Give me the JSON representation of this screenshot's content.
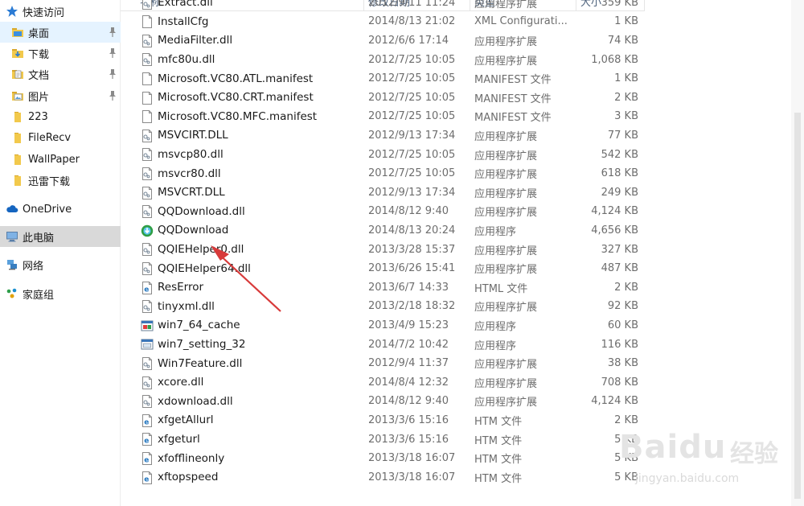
{
  "nav": {
    "items": [
      {
        "label": "快速访问",
        "icon": "star-icon",
        "kind": "quick",
        "pinned": false
      },
      {
        "label": "桌面",
        "icon": "desktop-folder-icon",
        "kind": "folder-blue",
        "pinned": true,
        "selected": true
      },
      {
        "label": "下载",
        "icon": "download-folder-icon",
        "kind": "folder-down",
        "pinned": true
      },
      {
        "label": "文档",
        "icon": "documents-folder-icon",
        "kind": "folder-doc",
        "pinned": true
      },
      {
        "label": "图片",
        "icon": "pictures-folder-icon",
        "kind": "folder-pic",
        "pinned": true
      },
      {
        "label": "223",
        "icon": "folder-icon",
        "kind": "folder",
        "pinned": false
      },
      {
        "label": "FileRecv",
        "icon": "folder-icon",
        "kind": "folder",
        "pinned": false
      },
      {
        "label": "WallPaper",
        "icon": "folder-icon",
        "kind": "folder",
        "pinned": false
      },
      {
        "label": "迅雷下载",
        "icon": "folder-icon",
        "kind": "folder",
        "pinned": false
      },
      {
        "label": "OneDrive",
        "icon": "onedrive-cloud-icon",
        "kind": "cloud",
        "pinned": false
      },
      {
        "label": "此电脑",
        "icon": "this-pc-icon",
        "kind": "pc",
        "pinned": false,
        "pcSelected": true
      },
      {
        "label": "网络",
        "icon": "network-icon",
        "kind": "network",
        "pinned": false
      },
      {
        "label": "家庭组",
        "icon": "homegroup-icon",
        "kind": "homegroup",
        "pinned": false
      }
    ]
  },
  "header": {
    "name": "名称",
    "date": "修改日期",
    "type": "类型",
    "size": "大小"
  },
  "files": [
    {
      "name": "Extract.dll",
      "date": "2012/9/11 11:24",
      "type": "应用程序扩展",
      "size": "359 KB",
      "icon": "dll-file-icon"
    },
    {
      "name": "InstallCfg",
      "date": "2014/8/13 21:02",
      "type": "XML Configurati...",
      "size": "1 KB",
      "icon": "blank-file-icon"
    },
    {
      "name": "MediaFilter.dll",
      "date": "2012/6/6 17:14",
      "type": "应用程序扩展",
      "size": "74 KB",
      "icon": "dll-file-icon"
    },
    {
      "name": "mfc80u.dll",
      "date": "2012/7/25 10:05",
      "type": "应用程序扩展",
      "size": "1,068 KB",
      "icon": "dll-file-icon"
    },
    {
      "name": "Microsoft.VC80.ATL.manifest",
      "date": "2012/7/25 10:05",
      "type": "MANIFEST 文件",
      "size": "1 KB",
      "icon": "blank-file-icon"
    },
    {
      "name": "Microsoft.VC80.CRT.manifest",
      "date": "2012/7/25 10:05",
      "type": "MANIFEST 文件",
      "size": "2 KB",
      "icon": "blank-file-icon"
    },
    {
      "name": "Microsoft.VC80.MFC.manifest",
      "date": "2012/7/25 10:05",
      "type": "MANIFEST 文件",
      "size": "3 KB",
      "icon": "blank-file-icon"
    },
    {
      "name": "MSVCIRT.DLL",
      "date": "2012/9/13 17:34",
      "type": "应用程序扩展",
      "size": "77 KB",
      "icon": "dll-file-icon"
    },
    {
      "name": "msvcp80.dll",
      "date": "2012/7/25 10:05",
      "type": "应用程序扩展",
      "size": "542 KB",
      "icon": "dll-file-icon"
    },
    {
      "name": "msvcr80.dll",
      "date": "2012/7/25 10:05",
      "type": "应用程序扩展",
      "size": "618 KB",
      "icon": "dll-file-icon"
    },
    {
      "name": "MSVCRT.DLL",
      "date": "2012/9/13 17:34",
      "type": "应用程序扩展",
      "size": "249 KB",
      "icon": "dll-file-icon"
    },
    {
      "name": "QQDownload.dll",
      "date": "2014/8/12 9:40",
      "type": "应用程序扩展",
      "size": "4,124 KB",
      "icon": "dll-file-icon"
    },
    {
      "name": "QQDownload",
      "date": "2014/8/13 20:24",
      "type": "应用程序",
      "size": "4,656 KB",
      "icon": "qqdownload-app-icon"
    },
    {
      "name": "QQIEHelper0.dll",
      "date": "2013/3/28 15:37",
      "type": "应用程序扩展",
      "size": "327 KB",
      "icon": "dll-file-icon"
    },
    {
      "name": "QQIEHelper64.dll",
      "date": "2013/6/26 15:41",
      "type": "应用程序扩展",
      "size": "487 KB",
      "icon": "dll-file-icon"
    },
    {
      "name": "ResError",
      "date": "2013/6/7 14:33",
      "type": "HTML 文件",
      "size": "2 KB",
      "icon": "html-file-icon"
    },
    {
      "name": "tinyxml.dll",
      "date": "2013/2/18 18:32",
      "type": "应用程序扩展",
      "size": "92 KB",
      "icon": "dll-file-icon"
    },
    {
      "name": "win7_64_cache",
      "date": "2013/4/9 15:23",
      "type": "应用程序",
      "size": "60 KB",
      "icon": "exe-app-icon"
    },
    {
      "name": "win7_setting_32",
      "date": "2014/7/2 10:42",
      "type": "应用程序",
      "size": "116 KB",
      "icon": "exe-window-icon"
    },
    {
      "name": "Win7Feature.dll",
      "date": "2012/9/4 11:37",
      "type": "应用程序扩展",
      "size": "38 KB",
      "icon": "dll-file-icon"
    },
    {
      "name": "xcore.dll",
      "date": "2014/8/4 12:32",
      "type": "应用程序扩展",
      "size": "708 KB",
      "icon": "dll-file-icon"
    },
    {
      "name": "xdownload.dll",
      "date": "2014/8/12 9:40",
      "type": "应用程序扩展",
      "size": "4,124 KB",
      "icon": "dll-file-icon"
    },
    {
      "name": "xfgetAllurl",
      "date": "2013/3/6 15:16",
      "type": "HTM 文件",
      "size": "2 KB",
      "icon": "html-file-icon"
    },
    {
      "name": "xfgeturl",
      "date": "2013/3/6 15:16",
      "type": "HTM 文件",
      "size": "5 KB",
      "icon": "html-file-icon"
    },
    {
      "name": "xfofflineonly",
      "date": "2013/3/18 16:07",
      "type": "HTM 文件",
      "size": "5 KB",
      "icon": "html-file-icon"
    },
    {
      "name": "xftopspeed",
      "date": "2013/3/18 16:07",
      "type": "HTM 文件",
      "size": "5 KB",
      "icon": "html-file-icon"
    }
  ],
  "watermark": {
    "brand": "Baidu",
    "cn": "经验",
    "url": "jingyan.baidu.com"
  },
  "colors": {
    "accent": "#cc3333",
    "selection": "#e5f3ff",
    "pcSelection": "#d9d9d9",
    "folder": "#f2c94c",
    "ie": "#1e73be"
  }
}
